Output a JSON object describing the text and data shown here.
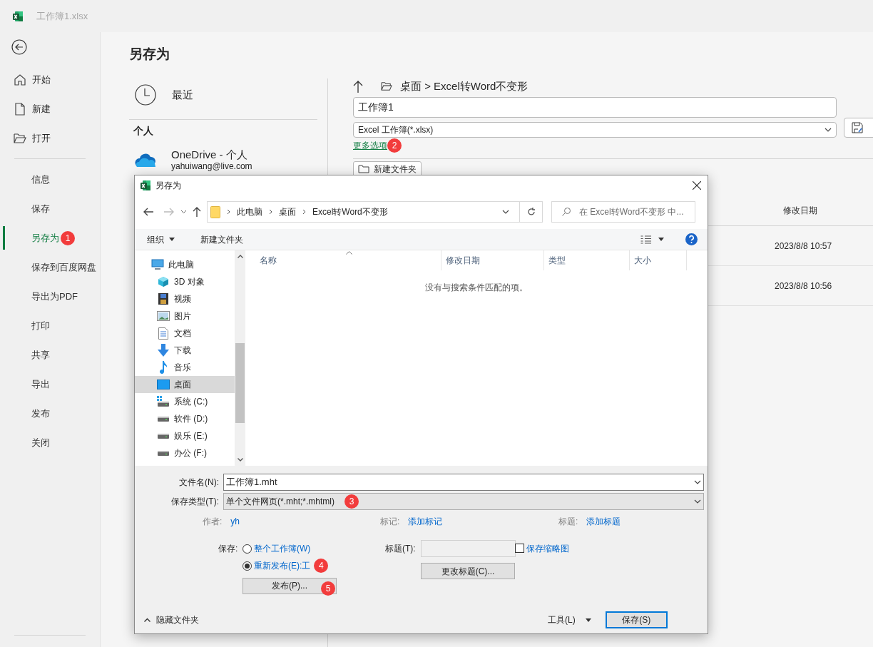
{
  "app": {
    "title": "工作簿1.xlsx"
  },
  "nav": {
    "top": [
      {
        "kind": "home",
        "label": "开始"
      },
      {
        "kind": "new",
        "label": "新建"
      },
      {
        "kind": "open",
        "label": "打开"
      }
    ],
    "items": [
      {
        "label": "信息",
        "selected": false
      },
      {
        "label": "保存",
        "selected": false
      },
      {
        "label": "另存为",
        "selected": true,
        "badge": "1"
      },
      {
        "label": "保存到百度网盘",
        "selected": false
      },
      {
        "label": "导出为PDF",
        "selected": false
      },
      {
        "label": "打印",
        "selected": false
      },
      {
        "label": "共享",
        "selected": false
      },
      {
        "label": "导出",
        "selected": false
      },
      {
        "label": "发布",
        "selected": false
      },
      {
        "label": "关闭",
        "selected": false
      }
    ]
  },
  "backstage": {
    "title": "另存为",
    "recent": "最近",
    "group": "个人",
    "onedrive": {
      "name": "OneDrive - 个人",
      "email": "yahuiwang@live.com"
    },
    "path": "桌面 > Excel转Word不变形",
    "filename": "工作簿1",
    "filetype": "Excel 工作簿(*.xlsx)",
    "more_options": {
      "label": "更多选项",
      "badge": "2"
    },
    "new_folder": "新建文件夹",
    "columns": {
      "column_2": "修改日期"
    },
    "files": [
      {
        "modified": "2023/8/8 10:57"
      },
      {
        "modified": "2023/8/8 10:56"
      }
    ]
  },
  "dialog": {
    "title": "另存为",
    "breadcrumbs": [
      "此电脑",
      "桌面",
      "Excel转Word不变形"
    ],
    "search_placeholder": "在 Excel转Word不变形 中...",
    "toolbar": {
      "organize": "组织",
      "new_folder": "新建文件夹"
    },
    "tree": [
      {
        "label": "此电脑",
        "kind": "pc",
        "selected": false,
        "children": [
          {
            "label": "3D 对象",
            "kind": "cube",
            "selected": false
          },
          {
            "label": "视频",
            "kind": "film",
            "selected": false
          },
          {
            "label": "图片",
            "kind": "image",
            "selected": false
          },
          {
            "label": "文档",
            "kind": "doc",
            "selected": false
          },
          {
            "label": "下载",
            "kind": "download",
            "selected": false
          },
          {
            "label": "音乐",
            "kind": "music",
            "selected": false
          },
          {
            "label": "桌面",
            "kind": "desktop",
            "selected": true
          },
          {
            "label": "系统 (C:)",
            "kind": "sysdrive",
            "selected": false
          },
          {
            "label": "软件 (D:)",
            "kind": "drive",
            "selected": false
          },
          {
            "label": "娱乐 (E:)",
            "kind": "drive",
            "selected": false
          },
          {
            "label": "办公 (F:)",
            "kind": "drive",
            "selected": false
          }
        ]
      }
    ],
    "columns": [
      "名称",
      "修改日期",
      "类型",
      "大小"
    ],
    "empty_message": "没有与搜索条件匹配的项。",
    "filename": {
      "label": "文件名(N):",
      "value": "工作簿1.mht"
    },
    "filetype": {
      "label": "保存类型(T):",
      "value": "单个文件网页(*.mht;*.mhtml)",
      "badge": "3"
    },
    "meta": [
      {
        "label": "作者:",
        "value": "yh"
      },
      {
        "label": "标记:",
        "value": "添加标记"
      },
      {
        "label": "标题:",
        "value": "添加标题"
      }
    ],
    "save_scope": {
      "label": "保存:",
      "options": [
        {
          "label": "整个工作簿(W)",
          "selected": false
        },
        {
          "label": "重新发布(E):工",
          "selected": true,
          "badge": "4"
        }
      ]
    },
    "publish_button": {
      "label": "发布(P)...",
      "badge": "5"
    },
    "title_field": {
      "label": "标题(T):",
      "disabled": true
    },
    "change_title_button": "更改标题(C)...",
    "thumbnail": {
      "label": "保存缩略图",
      "checked": false
    },
    "hide_folders": "隐藏文件夹",
    "tools": "工具(L)",
    "save_button": "保存(S)"
  }
}
